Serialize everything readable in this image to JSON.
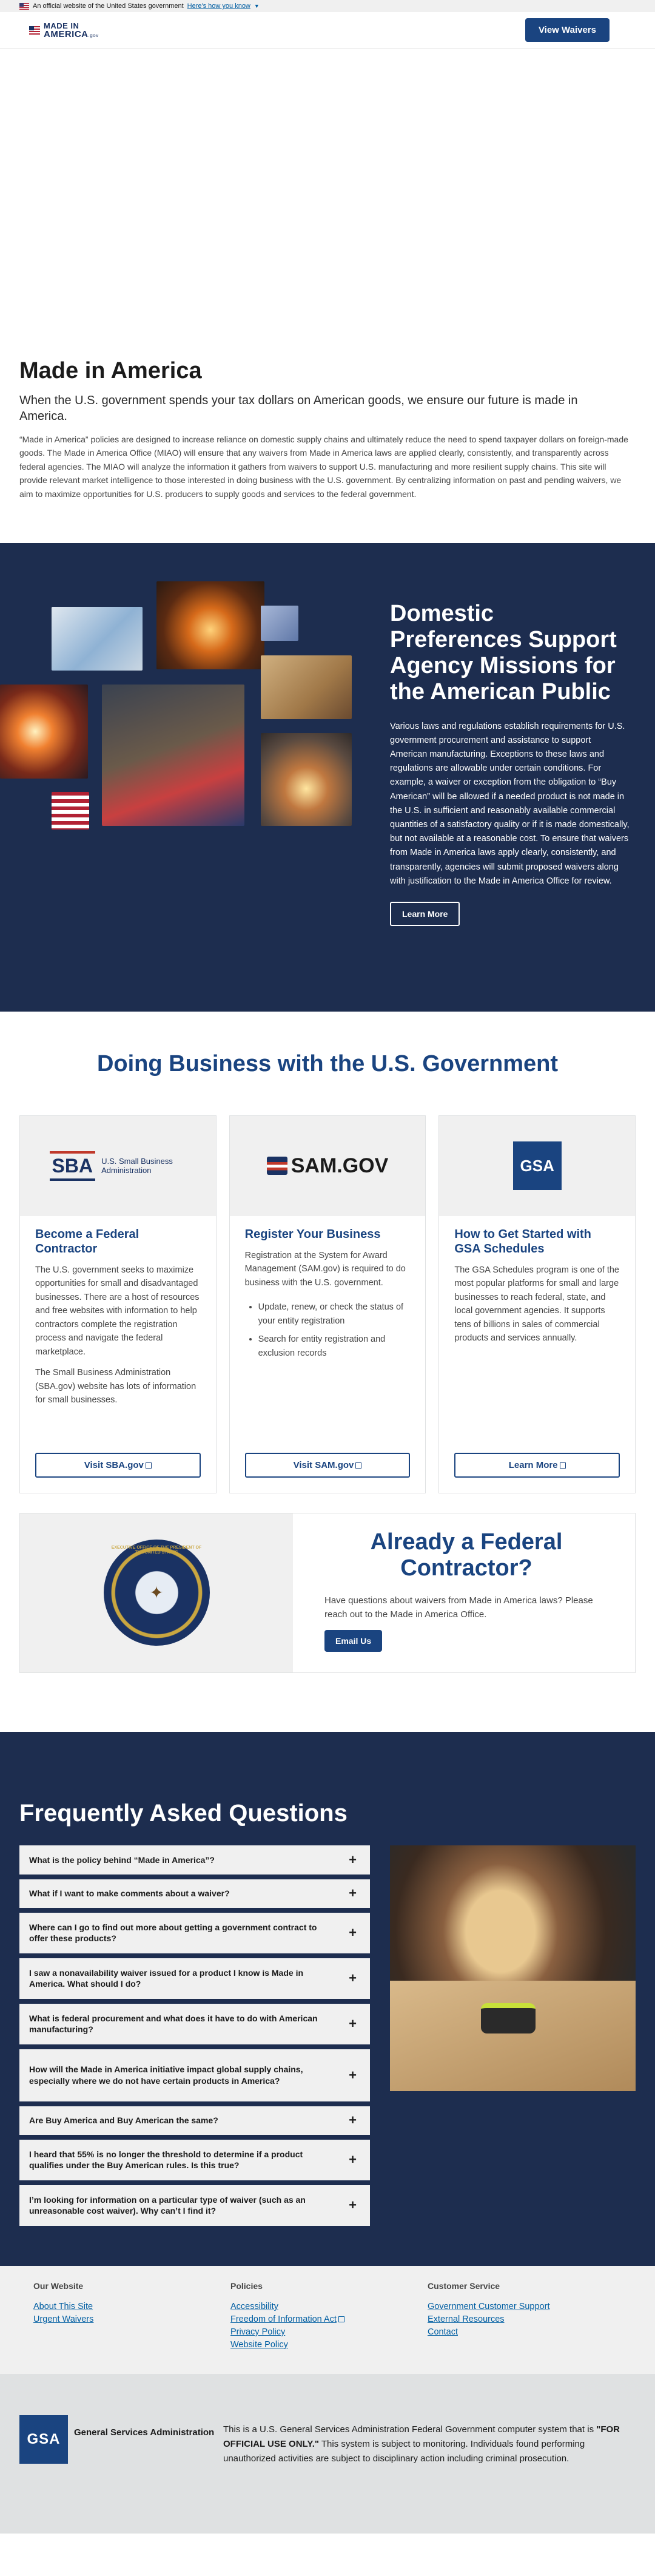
{
  "gov_banner": {
    "text": "An official website of the United States government",
    "link": "Here's how you know"
  },
  "header": {
    "logo_line1": "MADE IN",
    "logo_line2": "AMERICA",
    "logo_suffix": ".gov",
    "cta": "View Waivers"
  },
  "intro": {
    "title": "Made in America",
    "lead": "When the U.S. government spends your tax dollars on American goods, we ensure our future is made in America.",
    "body": "“Made in America” policies are designed to increase reliance on domestic supply chains and ultimately reduce the need to spend taxpayer dollars on foreign-made goods. The Made in America Office (MIAO) will ensure that any waivers from Made in America laws are applied clearly, consistently, and transparently across federal agencies. The MIAO will analyze the information it gathers from waivers to support U.S. manufacturing and more resilient supply chains. This site will provide relevant market intelligence to those interested in doing business with the U.S. government. By centralizing information on past and pending waivers, we aim to maximize opportunities for U.S. producers to supply goods and services to the federal government."
  },
  "domestic": {
    "title": "Domestic Preferences Support Agency Missions for the American Public",
    "body": "Various laws and regulations establish requirements for U.S. government procurement and assistance to support American manufacturing. Exceptions to these laws and regulations are allowable under certain conditions. For example, a waiver or exception from the obligation to “Buy American” will be allowed if a needed product is not made in the U.S. in sufficient and reasonably available commercial quantities of a satisfactory quality or if it is made domestically, but not available at a reasonable cost. To ensure that waivers from Made in America laws apply clearly, consistently, and transparently, agencies will submit proposed waivers along with justification to the Made in America Office for review.",
    "button": "Learn More"
  },
  "business": {
    "title": "Doing Business with the U.S. Government",
    "cards": [
      {
        "logo_text": "SBA",
        "logo_sub": "U.S. Small Business Administration",
        "title": "Become a Federal Contractor",
        "paragraphs": [
          "The U.S. government seeks to maximize opportunities for small and disadvantaged businesses. There are a host of resources and free websites with information to help contractors complete the registration process and navigate the federal marketplace.",
          "The Small Business Administration (SBA.gov) website has lots of information for small businesses."
        ],
        "button": "Visit SBA.gov"
      },
      {
        "logo_text": "SAM.GOV",
        "title": "Register Your Business",
        "paragraphs": [
          "Registration at the System for Award Management (SAM.gov) is required to do business with the U.S. government."
        ],
        "bullets": [
          "Update, renew, or check the status of your entity registration",
          "Search for entity registration and exclusion records"
        ],
        "button": "Visit SAM.gov"
      },
      {
        "logo_text": "GSA",
        "title": "How to Get Started with GSA Schedules",
        "paragraphs": [
          "The GSA Schedules program is one of the most popular platforms for small and large businesses to reach federal, state, and local government agencies. It supports tens of billions in sales of commercial products and services annually."
        ],
        "button": "Learn More"
      }
    ]
  },
  "federal": {
    "seal_text": "EXECUTIVE OFFICE OF THE PRESIDENT OF THE UNITED STATES",
    "title": "Already a Federal Contractor?",
    "body": "Have questions about waivers from Made in America laws? Please reach out to the Made in America Office.",
    "button": "Email Us"
  },
  "faq": {
    "title": "Frequently Asked Questions",
    "items": [
      "What is the policy behind “Made in America”?",
      "What if I want to make comments about a waiver?",
      "Where can I go to find out more about getting a government contract to offer these products?",
      "I saw a nonavailability waiver issued for a product I know is Made in America. What should I do?",
      "What is federal procurement and what does it have to do with American manufacturing?",
      "How will the Made in America initiative impact global supply chains, especially where we do not have certain products in America?",
      "Are Buy America and Buy American the same?",
      "I heard that 55% is no longer the threshold to determine if a product qualifies under the Buy American rules. Is this true?",
      "I’m looking for information on a particular type of waiver (such as an unreasonable cost waiver). Why can’t I find it?"
    ]
  },
  "footer": {
    "columns": [
      {
        "heading": "Our Website",
        "links": [
          "About This Site",
          "Urgent Waivers"
        ]
      },
      {
        "heading": "Policies",
        "links": [
          "Accessibility",
          "Freedom of Information Act",
          "Privacy Policy",
          "Website Policy"
        ]
      },
      {
        "heading": "Customer Service",
        "links": [
          "Government Customer Support",
          "External Resources",
          "Contact"
        ]
      }
    ],
    "agency_logo": "GSA",
    "agency_name": "General Services Administration",
    "disclaimer_pre": "This is a U.S. General Services Administration Federal Government computer system that is ",
    "disclaimer_strong": "\"FOR OFFICIAL USE ONLY.\"",
    "disclaimer_post": " This system is subject to monitoring. Individuals found performing unauthorized activities are subject to disciplinary action including criminal prosecution."
  },
  "colors": {
    "navy": "#1d2d4f",
    "primary": "#1a4480",
    "link": "#005ea2",
    "light_gray": "#f0f0f0"
  }
}
